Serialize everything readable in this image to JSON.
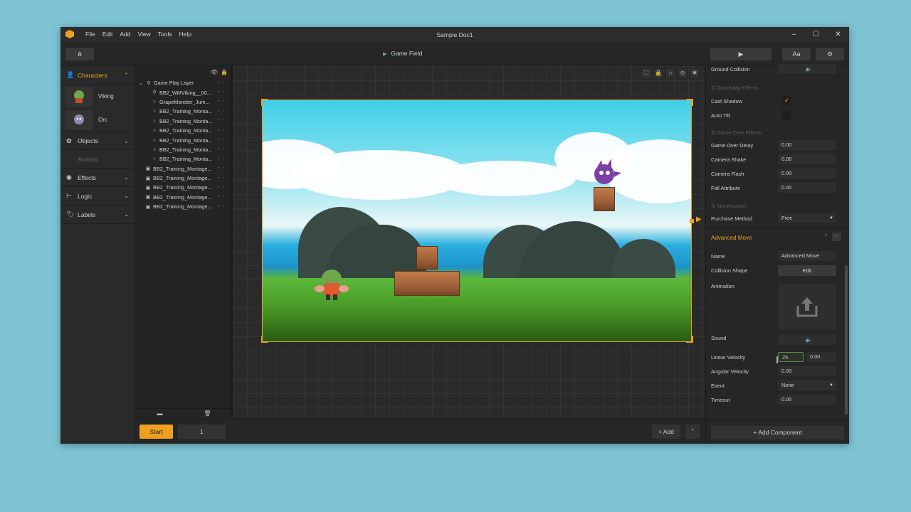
{
  "window": {
    "title": "Sample Doc1"
  },
  "menu": [
    "File",
    "Edit",
    "Add",
    "View",
    "Tools",
    "Help"
  ],
  "toolbar": {
    "breadcrumb": "Game Field",
    "font_label": "Aa"
  },
  "sidebar": {
    "characters_label": "Characters",
    "characters": [
      {
        "name": "Viking"
      },
      {
        "name": "Orc"
      }
    ],
    "sections": [
      {
        "label": "Objects"
      },
      {
        "label": "Actions"
      },
      {
        "label": "Effects"
      },
      {
        "label": "Logic"
      },
      {
        "label": "Labels"
      }
    ]
  },
  "layers": {
    "root": "Game Play Layer",
    "items": [
      "BB2_WMViking__00...",
      "GrapeMonster_Jum...",
      "BB2_Training_Monta...",
      "BB2_Training_Monta...",
      "BB2_Training_Monta...",
      "BB2_Training_Monta...",
      "BB2_Training_Monta...",
      "BB2_Training_Monta...",
      "BB2_Training_Montage...",
      "BB2_Training_Montage...",
      "BB2_Training_Montage...",
      "BB2_Training_Montage...",
      "BB2_Training_Montage..."
    ]
  },
  "timeline": {
    "start_label": "Start",
    "frame": "1",
    "add_label": "+ Add"
  },
  "props": {
    "ground_collision": "Ground Collision",
    "gameplay_effects_head": "Gameplay Effects",
    "cast_shadow": "Cast Shadow",
    "auto_tilt": "Auto Tilt",
    "game_over_effects_head": "Game Over Effects",
    "game_over_delay": "Game Over Delay",
    "game_over_delay_val": "0.00",
    "camera_shake": "Camera Shake",
    "camera_shake_val": "0.00",
    "camera_flash": "Camera Flash",
    "camera_flash_val": "0.00",
    "fall_attribute": "Fall Attribute",
    "fall_attribute_val": "0.00",
    "monetization_head": "Monetization",
    "purchase_method": "Purchase Method",
    "purchase_method_val": "Free",
    "advanced_move_head": "Advanced Move",
    "name": "Name",
    "name_val": "Advanced Move",
    "collision_shape": "Collision Shape",
    "edit_label": "Edit",
    "animation": "Animation",
    "sound": "Sound",
    "linear_velocity": "Linear Velocity",
    "linear_velocity_x": "25",
    "linear_velocity_y": "0.00",
    "angular_velocity": "Angular Velocity",
    "angular_velocity_val": "0.00",
    "event": "Event",
    "event_val": "None",
    "timeout": "Timeout",
    "timeout_val": "0.00",
    "add_component": "+ Add Component"
  },
  "colors": {
    "accent": "#f0a020",
    "background": "#7ec3d3"
  }
}
